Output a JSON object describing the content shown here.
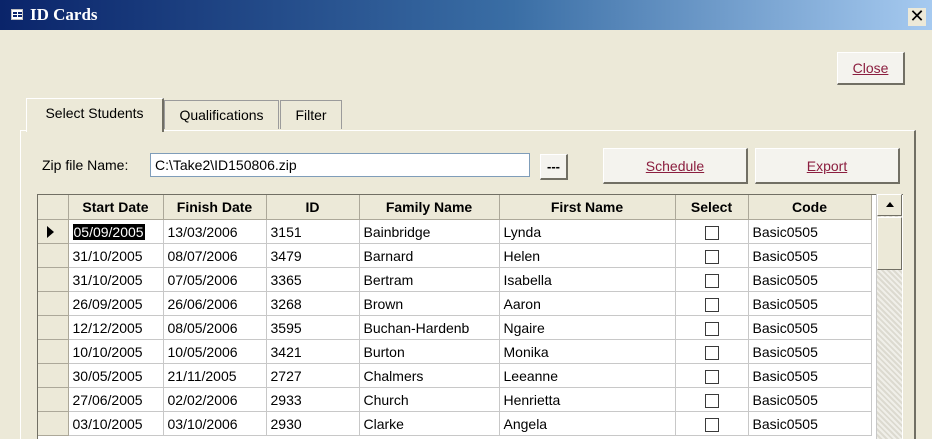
{
  "window": {
    "title": "ID Cards",
    "close_glyph": "✕"
  },
  "toolbar": {
    "close_label": "Close"
  },
  "tabs": [
    {
      "label": "Select Students",
      "active": true
    },
    {
      "label": "Qualifications",
      "active": false
    },
    {
      "label": "Filter",
      "active": false
    }
  ],
  "zip": {
    "label": "Zip file Name:",
    "value": "C:\\Take2\\ID150806.zip"
  },
  "buttons": {
    "browse": "---",
    "schedule": "Schedule",
    "export": "Export"
  },
  "grid": {
    "columns": [
      "Start Date",
      "Finish Date",
      "ID",
      "Family Name",
      "First Name",
      "Select",
      "Code"
    ],
    "rows": [
      [
        "05/09/2005",
        "13/03/2006",
        "3151",
        "Bainbridge",
        "Lynda",
        false,
        "Basic0505"
      ],
      [
        "31/10/2005",
        "08/07/2006",
        "3479",
        "Barnard",
        "Helen",
        false,
        "Basic0505"
      ],
      [
        "31/10/2005",
        "07/05/2006",
        "3365",
        "Bertram",
        "Isabella",
        false,
        "Basic0505"
      ],
      [
        "26/09/2005",
        "26/06/2006",
        "3268",
        "Brown",
        "Aaron",
        false,
        "Basic0505"
      ],
      [
        "12/12/2005",
        "08/05/2006",
        "3595",
        "Buchan-Hardenb",
        "Ngaire",
        false,
        "Basic0505"
      ],
      [
        "10/10/2005",
        "10/05/2006",
        "3421",
        "Burton",
        "Monika",
        false,
        "Basic0505"
      ],
      [
        "30/05/2005",
        "21/11/2005",
        "2727",
        "Chalmers",
        "Leeanne",
        false,
        "Basic0505"
      ],
      [
        "27/06/2005",
        "02/02/2006",
        "2933",
        "Church",
        "Henrietta",
        false,
        "Basic0505"
      ],
      [
        "03/10/2005",
        "03/10/2006",
        "2930",
        "Clarke",
        "Angela",
        false,
        "Basic0505"
      ]
    ],
    "current_row": 0
  },
  "colors": {
    "accent_text": "#8b1e3f",
    "titlebar_start": "#0a246a",
    "titlebar_end": "#a6caf0"
  }
}
